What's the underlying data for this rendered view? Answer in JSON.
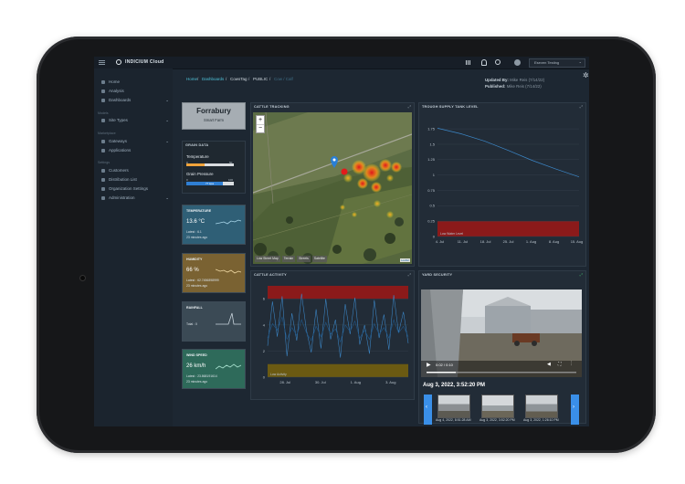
{
  "header": {
    "brand": "INDICIUM Cloud",
    "user": "Eseven Testing"
  },
  "sidebar": {
    "items": [
      "Home",
      "Analysis",
      "Dashboards"
    ],
    "section_models": "Models",
    "site_types": "Site Types",
    "section_marketplace": "Marketplace",
    "gateways": "Gateways",
    "applications": "Applications",
    "section_settings": "Settings",
    "customers": "Customers",
    "distribution_list": "Distribution List",
    "org_settings": "Organization Settings",
    "administration": "Administration"
  },
  "breadcrumb": {
    "home": "Home",
    "dashboards": "Dashboards",
    "cowstag": "CowsTag",
    "public": "PUBLIC",
    "current": "Cow / Calf"
  },
  "meta": {
    "updated_by": "Updated By:",
    "updated_val": "Mike Reis (7/14/22)",
    "published": "Published:",
    "published_val": "Mike Reis (7/14/22)"
  },
  "farm": {
    "name": "Forrabury",
    "type": "Smart Farm"
  },
  "grain": {
    "title": "GRAIN DATA",
    "temp_label": "Temperature",
    "temp_min": "0",
    "temp_max": "50",
    "pressure_label": "Grain Pressure",
    "pressure_min": "0",
    "pressure_max": "100",
    "pressure_value": "77 kpa",
    "temp_fill": 0.38,
    "pressure_fill": 0.77
  },
  "tiles": {
    "temperature": {
      "title": "TEMPERATURE",
      "value": "13.6 °C",
      "latest": "Latest : 6.1",
      "ago": "23 minutes ago",
      "color": "#2f5f76"
    },
    "humidity": {
      "title": "HUMIDITY",
      "value": "66 %",
      "latest": "Latest : 62.7456898999",
      "ago": "23 minutes ago",
      "color": "#7a6232"
    },
    "rainfall": {
      "title": "RAINFALL",
      "value": "",
      "latest": "Total : 0",
      "ago": "",
      "color": "#3b4a55"
    },
    "wind": {
      "title": "WIND SPEED",
      "value": "26 km/h",
      "latest": "Latest : 23.868191614",
      "ago": "23 minutes ago",
      "color": "#2e6a5a"
    }
  },
  "cattle_tracking": {
    "title": "CATTLE TRACKING",
    "zoom_in": "+",
    "zoom_out": "−",
    "layers": [
      "Low Street Map",
      "Terrain",
      "Streets",
      "Satellite"
    ],
    "attribution": "Leaflet"
  },
  "trough": {
    "title": "TROUGH SUPPLY TANK LEVEL",
    "band_label": "Low Water Level"
  },
  "cattle_activity": {
    "title": "CATTLE ACTIVITY",
    "band_label": "Low Activity"
  },
  "yard": {
    "title": "YARD SECURITY",
    "timecode": "0:02 / 0:10",
    "timestamp": "Aug 3, 2022, 3:52:20 PM",
    "thumbs": [
      "Aug 4, 2022, 8:51:28 AM",
      "Aug 3, 2022, 3:52:20 PM",
      "Aug 3, 2022, 1:26:10 PM"
    ]
  },
  "colors": {
    "accent": "#3aa7e0",
    "danger_band": "#8b1a1a",
    "low_band": "#6b5a12",
    "line": "#3c88c9"
  },
  "chart_data": [
    {
      "type": "line",
      "title": "TROUGH SUPPLY TANK LEVEL",
      "x": [
        "4. Jul",
        "11. Jul",
        "18. Jul",
        "25. Jul",
        "1. Aug",
        "8. Aug",
        "15. Aug"
      ],
      "series": [
        {
          "values": [
            1.76,
            1.67,
            1.55,
            1.4,
            1.24,
            1.1,
            0.97
          ]
        }
      ],
      "yticks": [
        "0",
        "0.25",
        "0.5",
        "0.75",
        "1",
        "1.25",
        "1.5",
        "1.75"
      ],
      "ylim": [
        0,
        1.9
      ],
      "bands": [
        {
          "from": 0,
          "to": 0.25,
          "label": "Low Water Level"
        }
      ]
    },
    {
      "type": "line",
      "title": "CATTLE ACTIVITY",
      "x": [
        "28. Jul",
        "30. Jul",
        "1. Aug",
        "3. Aug"
      ],
      "series": [
        {
          "values": [
            2.4,
            5.8,
            3.1,
            6.2,
            1.6,
            4.9,
            2.8,
            6.4,
            3.6,
            1.9,
            5.2,
            2.2,
            6.0,
            2.9,
            4.4,
            1.5,
            5.6,
            3.3,
            6.1,
            2.5,
            4.0,
            1.8,
            5.9,
            3.0,
            4.8,
            2.1,
            6.3,
            3.4,
            5.0,
            2.6
          ]
        },
        {
          "values": [
            3.0,
            4.1,
            3.6,
            4.6,
            2.9,
            3.8,
            3.2,
            4.4,
            3.4,
            2.8,
            3.9,
            3.1,
            4.2,
            3.3,
            3.7,
            2.7,
            4.0,
            3.5,
            4.3,
            3.0,
            3.6,
            2.9,
            4.1,
            3.3,
            3.8,
            3.0,
            4.4,
            3.4,
            3.9,
            3.1
          ]
        }
      ],
      "yticks": [
        "0",
        "2",
        "4",
        "6"
      ],
      "ylim": [
        0,
        7
      ],
      "bands": [
        {
          "from": 6,
          "to": 7,
          "label": ""
        },
        {
          "from": 0,
          "to": 1,
          "label": "Low Activity"
        }
      ]
    }
  ]
}
